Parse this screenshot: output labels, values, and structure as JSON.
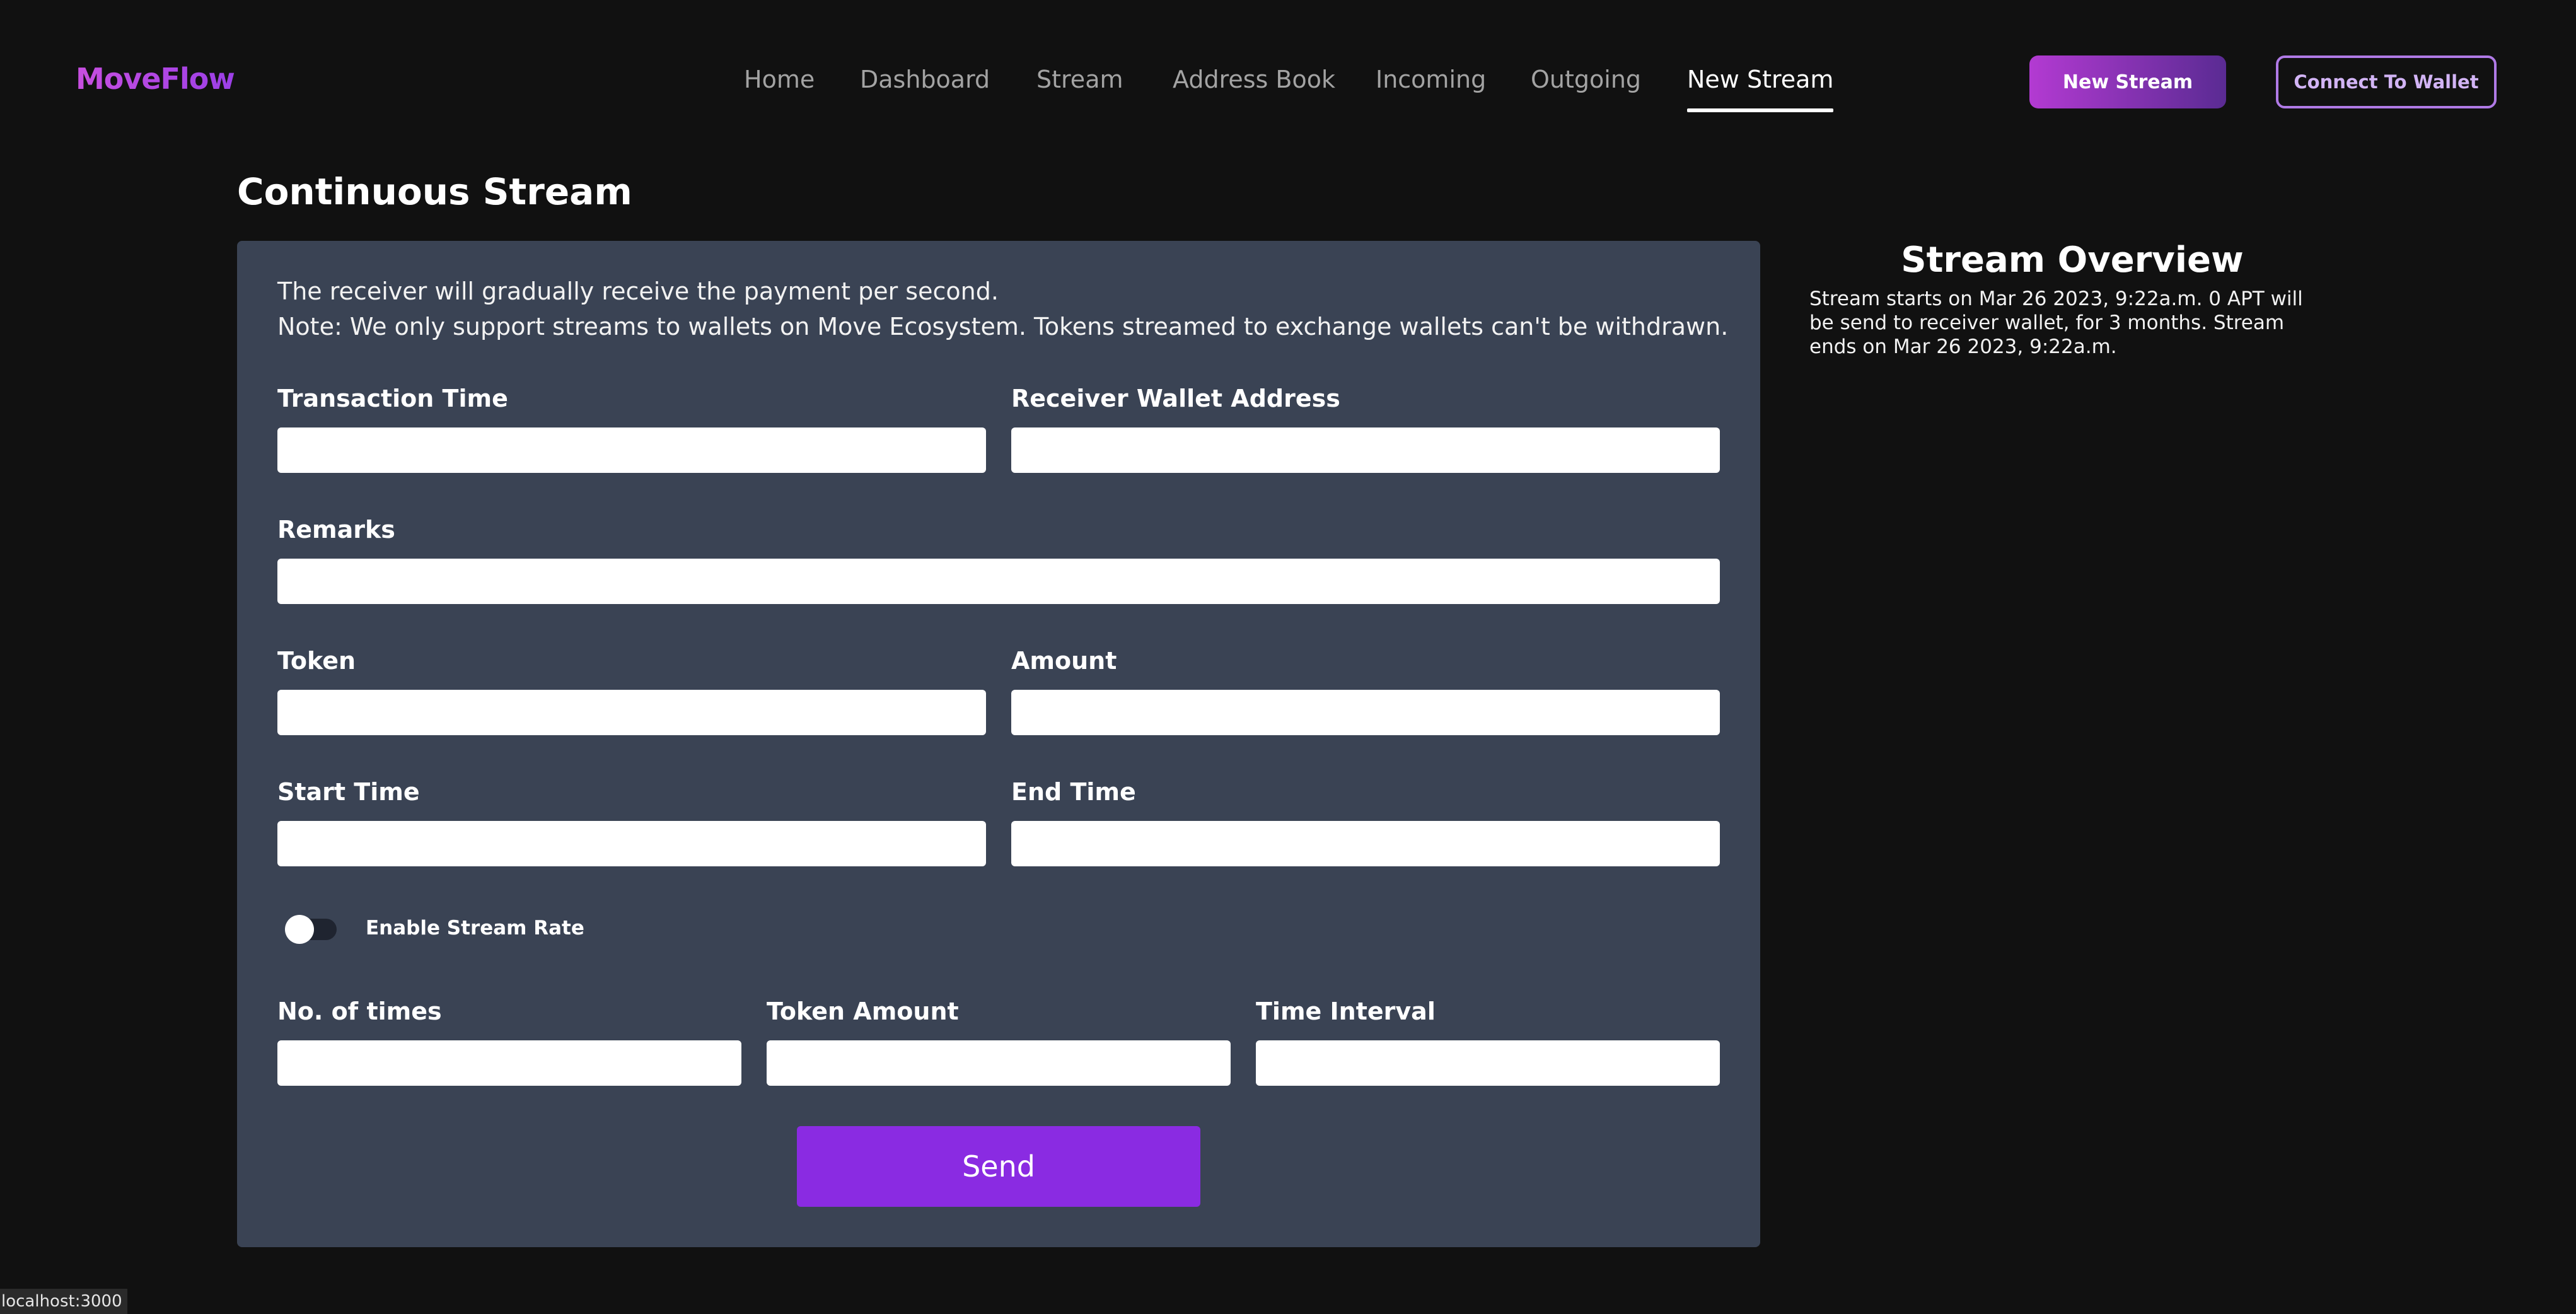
{
  "app": {
    "logo": "MoveFlow"
  },
  "nav": {
    "items": [
      {
        "label": "Home",
        "active": false
      },
      {
        "label": "Dashboard",
        "active": false
      },
      {
        "label": "Stream",
        "active": false
      },
      {
        "label": "Address Book",
        "active": false
      },
      {
        "label": "Incoming",
        "active": false
      },
      {
        "label": "Outgoing",
        "active": false
      },
      {
        "label": "New Stream",
        "active": true
      }
    ]
  },
  "header": {
    "new_stream_button": "New Stream",
    "connect_wallet_button": "Connect To Wallet"
  },
  "page": {
    "title": "Continuous Stream"
  },
  "form": {
    "intro_line1": "The receiver will gradually receive the payment per second.",
    "intro_line2": "Note: We only support streams to wallets on Move Ecosystem. Tokens streamed to exchange wallets can't be withdrawn.",
    "fields": {
      "transaction_time": {
        "label": "Transaction Time",
        "value": ""
      },
      "receiver_wallet_address": {
        "label": "Receiver Wallet Address",
        "value": ""
      },
      "remarks": {
        "label": "Remarks",
        "value": ""
      },
      "token": {
        "label": "Token",
        "value": ""
      },
      "amount": {
        "label": "Amount",
        "value": ""
      },
      "start_time": {
        "label": "Start Time",
        "value": ""
      },
      "end_time": {
        "label": "End Time",
        "value": ""
      },
      "no_of_times": {
        "label": "No. of times",
        "value": ""
      },
      "token_amount": {
        "label": "Token Amount",
        "value": ""
      },
      "time_interval": {
        "label": "Time Interval",
        "value": ""
      }
    },
    "toggle": {
      "label": "Enable Stream Rate",
      "enabled": false
    },
    "send_button": "Send"
  },
  "overview": {
    "title": "Stream Overview",
    "text": "Stream starts on Mar 26 2023, 9:22a.m. 0 APT will be send to receiver wallet, for 3 months. Stream ends on Mar 26 2023, 9:22a.m."
  },
  "status_bar": {
    "url": "localhost:3000"
  }
}
